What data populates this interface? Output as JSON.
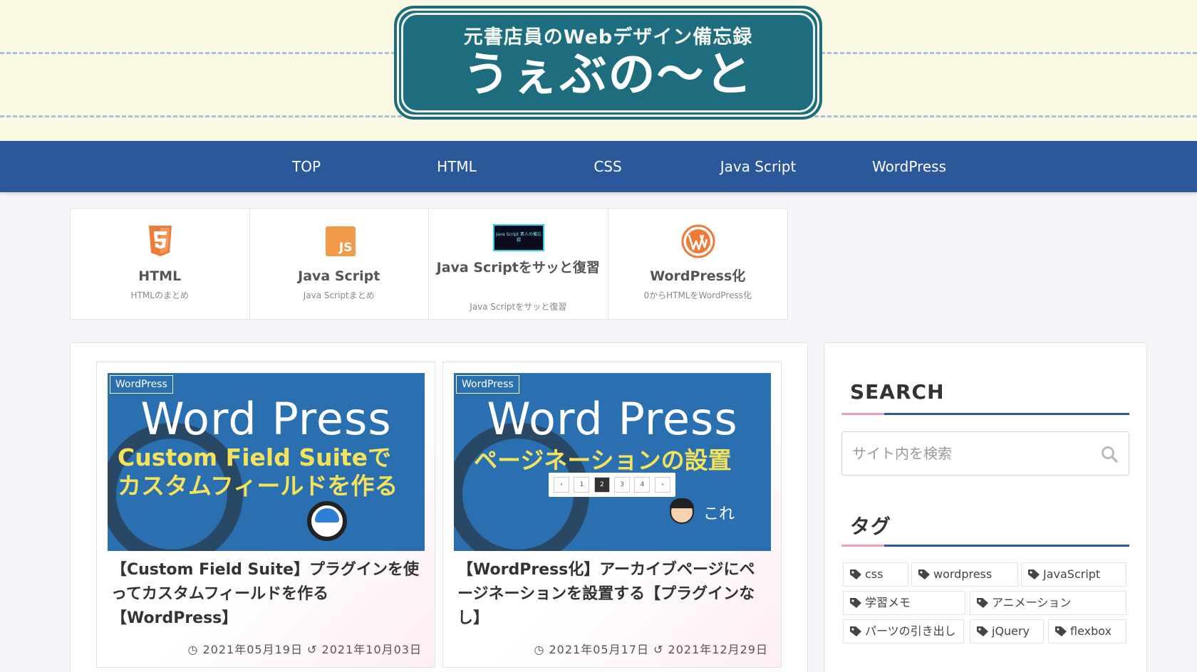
{
  "header": {
    "logo_subtitle": "元書店員のWebデザイン備忘録",
    "logo_title": "うぇぶの〜と"
  },
  "nav": {
    "items": [
      "TOP",
      "HTML",
      "CSS",
      "Java Script",
      "WordPress"
    ]
  },
  "categories": [
    {
      "title": "HTML",
      "desc": "HTMLのまとめ",
      "icon": "html5-icon"
    },
    {
      "title": "Java Script",
      "desc": "Java Scriptまとめ",
      "icon": "js-icon"
    },
    {
      "title": "Java Scriptをサッと復習",
      "desc": "Java Scriptをサッと復習",
      "icon": "js-review-thumbnail",
      "thumb_text": "Java Script 素人の備忘録"
    },
    {
      "title": "WordPress化",
      "desc": "0からHTMLをWordPress化",
      "icon": "wordpress-icon"
    }
  ],
  "posts": [
    {
      "category": "WordPress",
      "thumb_heading": "Word Press",
      "thumb_line1": "Custom Field Suiteで",
      "thumb_line2": "カスタムフィールドを作る",
      "title": "【Custom Field Suite】プラグインを使ってカスタムフィールドを作る【WordPress】",
      "published": "2021年05月19日",
      "updated": "2021年10月03日"
    },
    {
      "category": "WordPress",
      "thumb_heading": "Word Press",
      "thumb_line1": "ページネーションの設置",
      "thumb_pager": [
        "‹",
        "1",
        "2",
        "3",
        "4",
        "›"
      ],
      "thumb_note": "これ",
      "title": "【WordPress化】アーカイブページにページネーションを設置する【プラグインなし】",
      "published": "2021年05月17日",
      "updated": "2021年12月29日"
    }
  ],
  "sidebar": {
    "search_heading": "SEARCH",
    "search_placeholder": "サイト内を検索",
    "tags_heading": "タグ",
    "tags": [
      "css",
      "wordpress",
      "JavaScript",
      "学習メモ",
      "アニメーション",
      "パーツの引き出し",
      "jQuery",
      "flexbox"
    ]
  },
  "colors": {
    "nav": "#2b579b",
    "header_bg": "#fbf8e4",
    "logo": "#1d6d7e",
    "thumb_bg": "#2a6fb0",
    "accent_pink": "#e9a3b5"
  }
}
